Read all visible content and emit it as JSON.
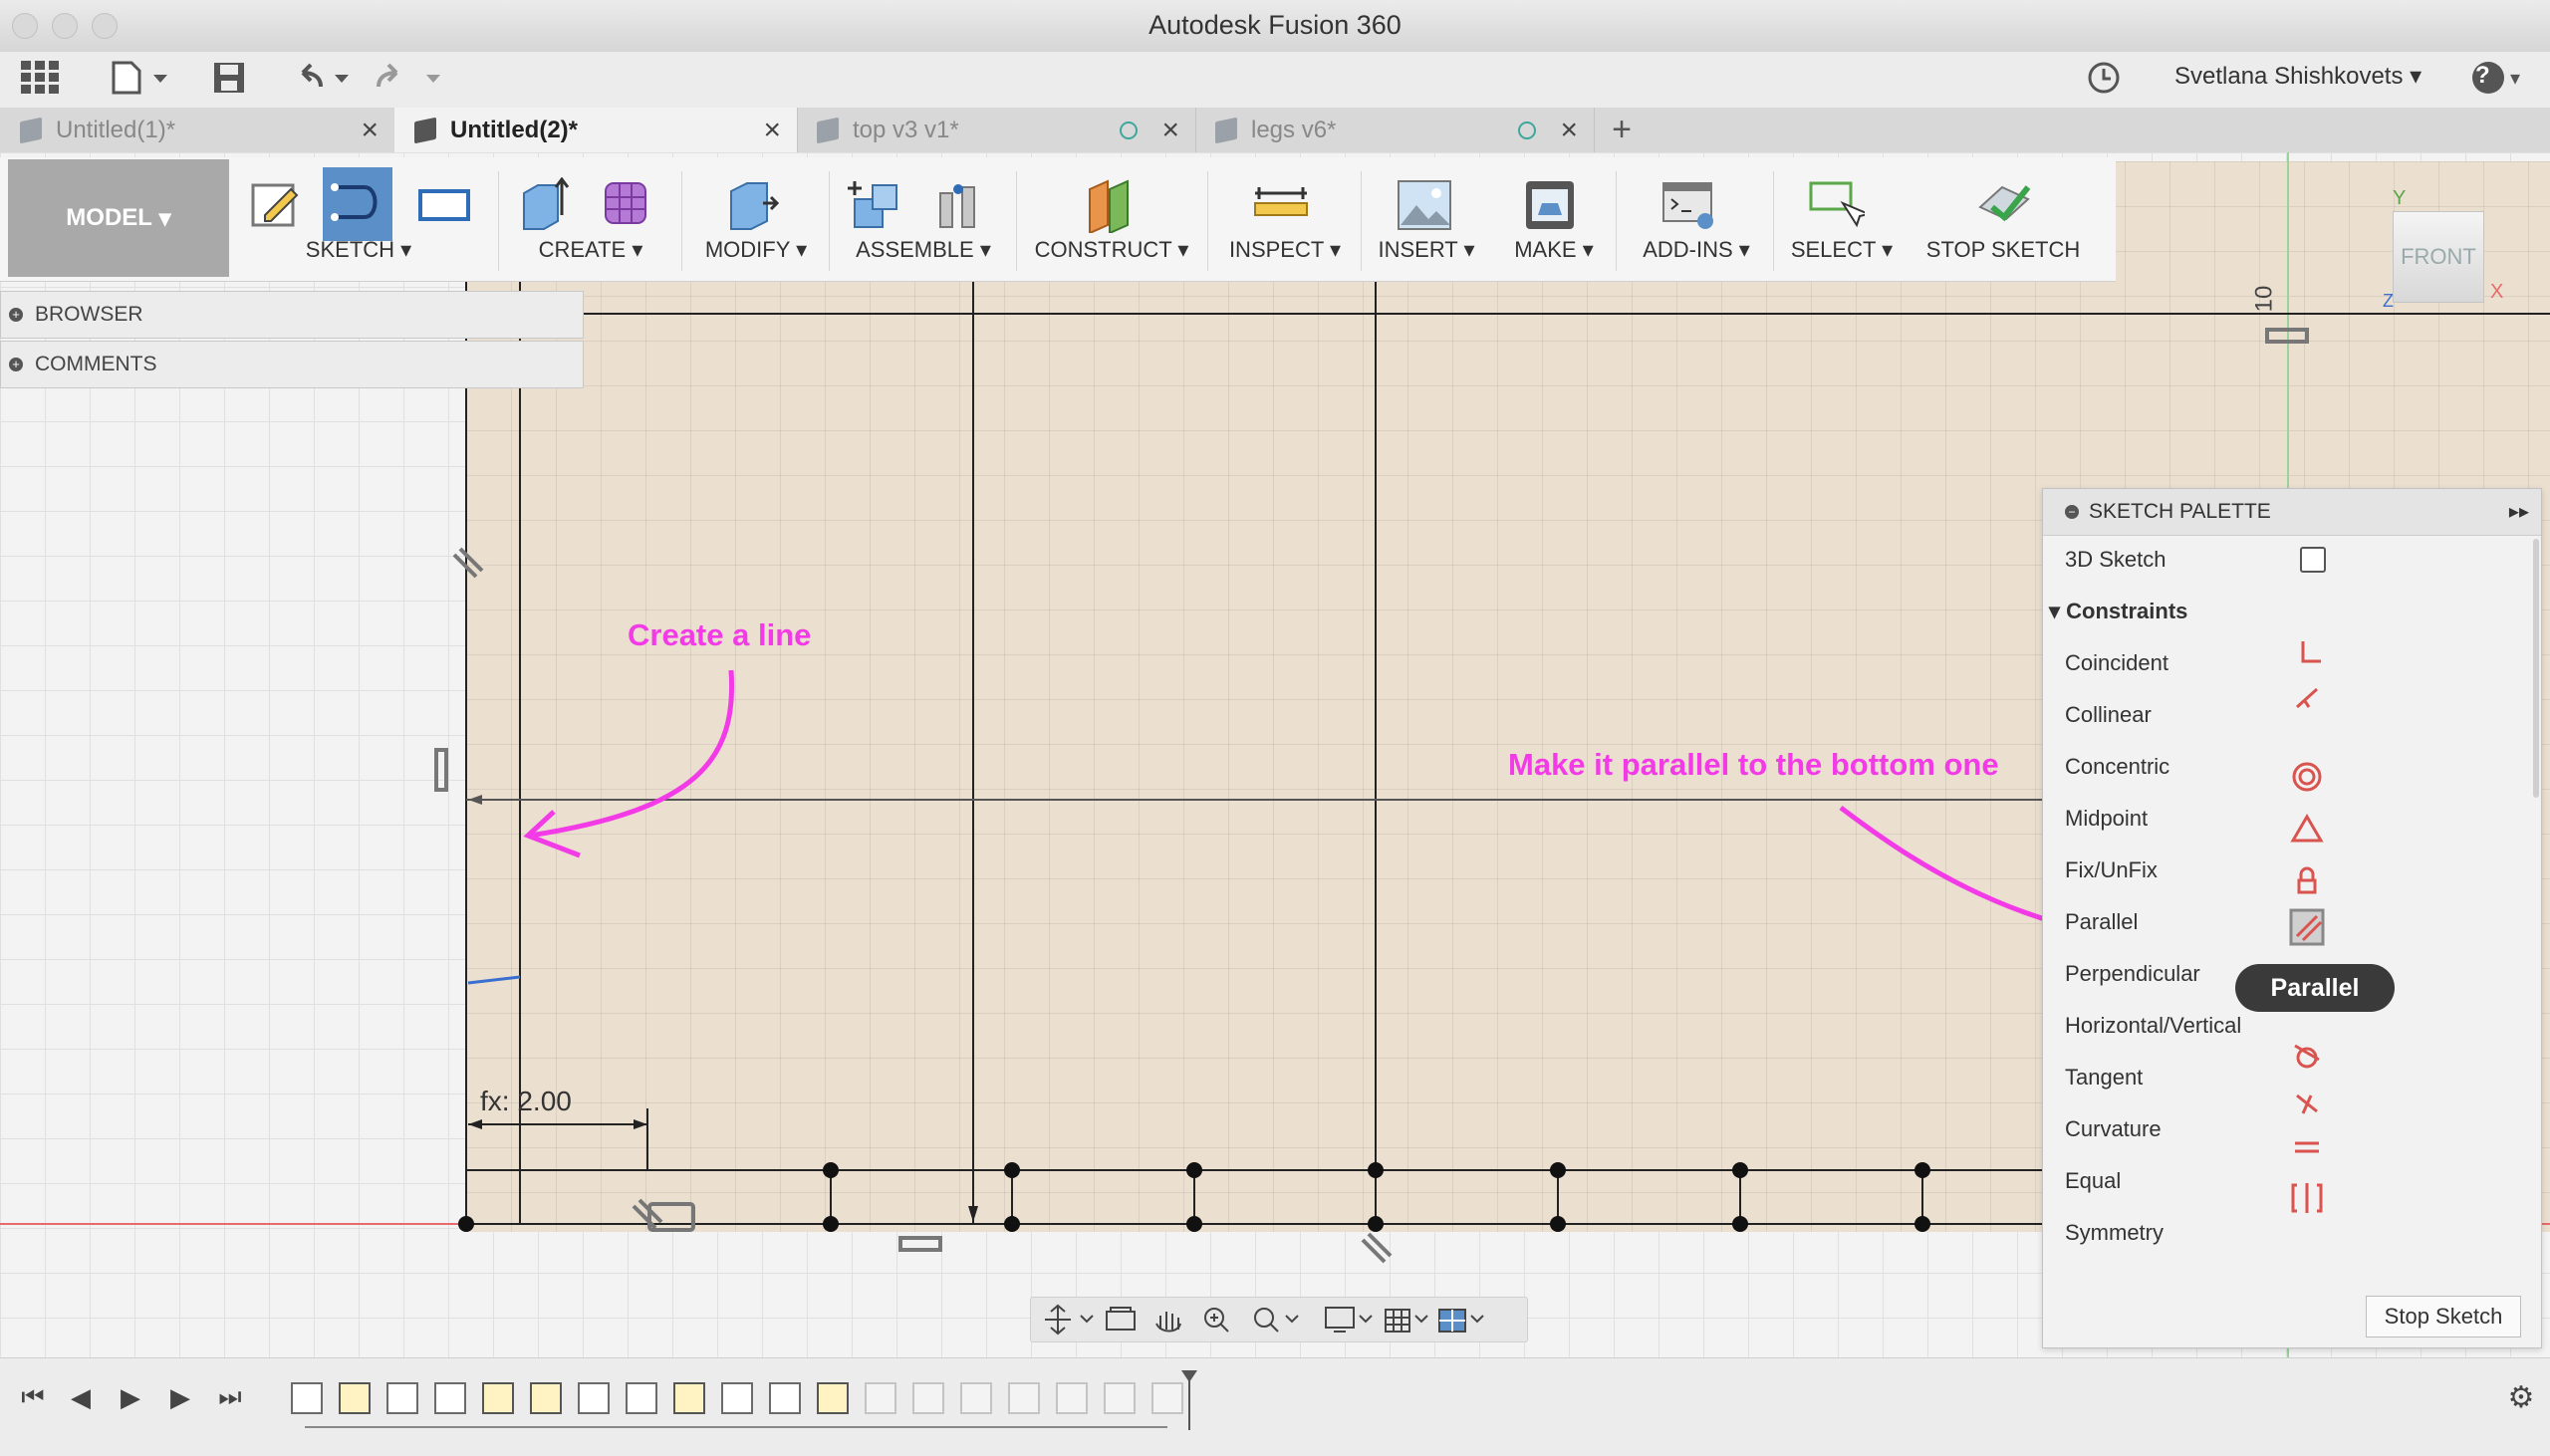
{
  "window": {
    "title": "Autodesk Fusion 360"
  },
  "toolbar": {
    "user_name": "Svetlana Shishkovets",
    "help": "?"
  },
  "tabs": [
    {
      "label": "Untitled(1)*",
      "active": false
    },
    {
      "label": "Untitled(2)*",
      "active": true
    },
    {
      "label": "top v3 v1*",
      "active": false
    },
    {
      "label": "legs v6*",
      "active": false
    }
  ],
  "ribbon": {
    "workspace": "MODEL",
    "groups": [
      "SKETCH",
      "CREATE",
      "MODIFY",
      "ASSEMBLE",
      "CONSTRUCT",
      "INSPECT",
      "INSERT",
      "MAKE",
      "ADD-INS",
      "SELECT",
      "STOP SKETCH"
    ]
  },
  "panels": {
    "browser": "BROWSER",
    "comments": "COMMENTS"
  },
  "viewcube": {
    "face": "FRONT",
    "axis_y": "Y",
    "axis_x": "X",
    "axis_z": "Z"
  },
  "canvas": {
    "ruler_value": "10",
    "dimension_label": "fx: 2.00"
  },
  "annotations": {
    "create_line": "Create a line",
    "make_parallel": "Make it parallel to the bottom one"
  },
  "palette": {
    "title": "SKETCH PALETTE",
    "sketch3d_label": "3D Sketch",
    "section": "Constraints",
    "constraints": [
      "Coincident",
      "Collinear",
      "Concentric",
      "Midpoint",
      "Fix/UnFix",
      "Parallel",
      "Perpendicular",
      "Horizontal/Vertical",
      "Tangent",
      "Curvature",
      "Equal",
      "Symmetry"
    ],
    "stop_button": "Stop Sketch",
    "tooltip": "Parallel"
  },
  "colors": {
    "annotation": "#f23be6",
    "active_tool": "#5b8fc7",
    "constraint_icon": "#d9534f",
    "sketch_region": "#ebdfd0"
  }
}
